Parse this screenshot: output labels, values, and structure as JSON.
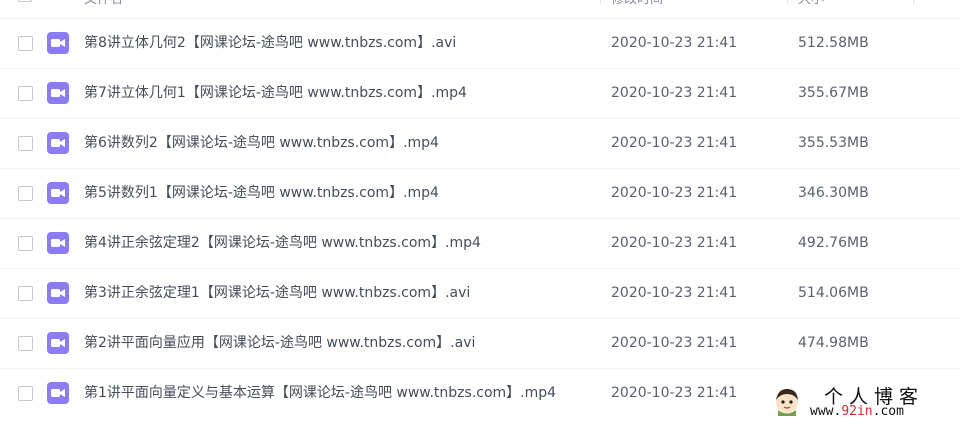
{
  "header": {
    "name_label": "文件名",
    "time_label": "修改时间",
    "size_label": "大小"
  },
  "files": [
    {
      "name": "第8讲立体几何2【网课论坛-途鸟吧 www.tnbzs.com】.avi",
      "modified": "2020-10-23 21:41",
      "size": "512.58MB",
      "icon": "video-icon"
    },
    {
      "name": "第7讲立体几何1【网课论坛-途鸟吧 www.tnbzs.com】.mp4",
      "modified": "2020-10-23 21:41",
      "size": "355.67MB",
      "icon": "video-icon"
    },
    {
      "name": "第6讲数列2【网课论坛-途鸟吧 www.tnbzs.com】.mp4",
      "modified": "2020-10-23 21:41",
      "size": "355.53MB",
      "icon": "video-icon"
    },
    {
      "name": "第5讲数列1【网课论坛-途鸟吧 www.tnbzs.com】.mp4",
      "modified": "2020-10-23 21:41",
      "size": "346.30MB",
      "icon": "video-icon"
    },
    {
      "name": "第4讲正余弦定理2【网课论坛-途鸟吧 www.tnbzs.com】.mp4",
      "modified": "2020-10-23 21:41",
      "size": "492.76MB",
      "icon": "video-icon"
    },
    {
      "name": "第3讲正余弦定理1【网课论坛-途鸟吧 www.tnbzs.com】.avi",
      "modified": "2020-10-23 21:41",
      "size": "514.06MB",
      "icon": "video-icon"
    },
    {
      "name": "第2讲平面向量应用【网课论坛-途鸟吧 www.tnbzs.com】.avi",
      "modified": "2020-10-23 21:41",
      "size": "474.98MB",
      "icon": "video-icon"
    },
    {
      "name": "第1讲平面向量定义与基本运算【网课论坛-途鸟吧 www.tnbzs.com】.mp4",
      "modified": "2020-10-23 21:41",
      "size": "",
      "icon": "video-icon"
    }
  ],
  "watermark": {
    "title": "个人博客",
    "url_prefix": "www.",
    "url_highlight": "92in",
    "url_suffix": ".com"
  },
  "colors": {
    "video_icon": "#8b7cf3",
    "sort_arrow": "#06a7ff",
    "url_highlight": "#d32a2a"
  }
}
